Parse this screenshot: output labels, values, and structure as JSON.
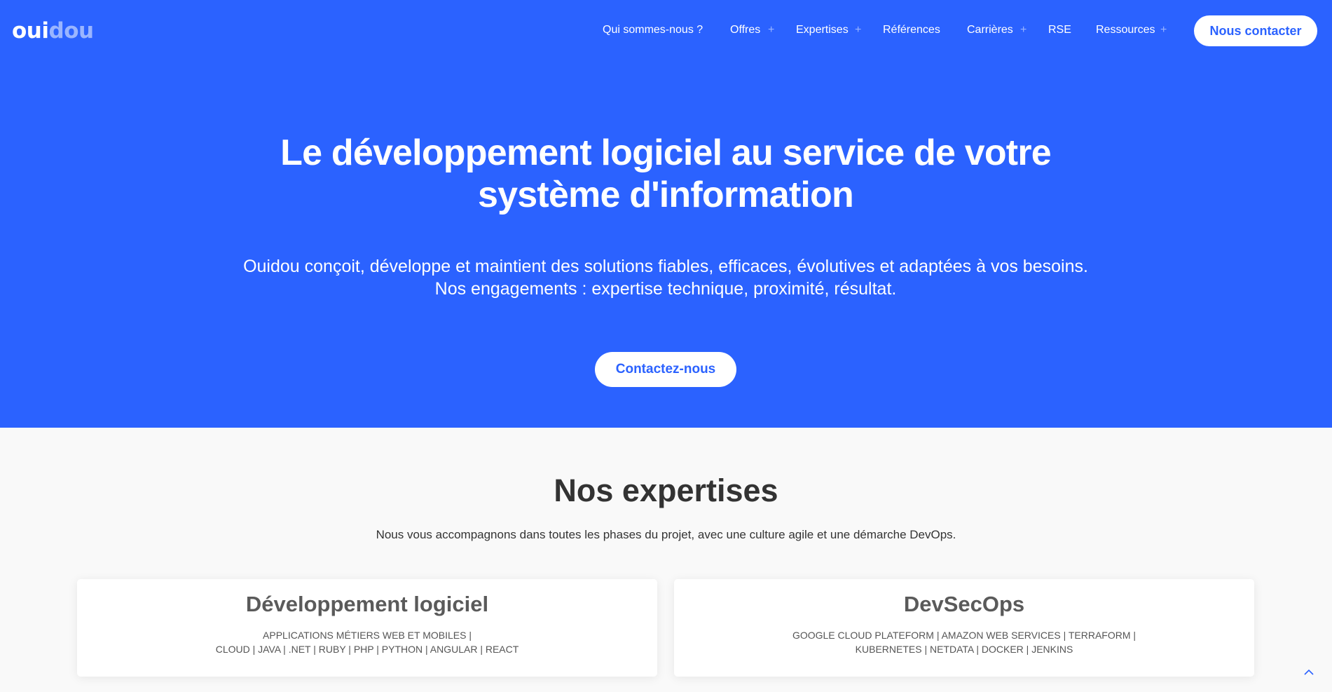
{
  "logo": {
    "part1": "oui",
    "part2": "dou"
  },
  "nav": {
    "items": [
      {
        "label": "Qui sommes-nous ?"
      },
      {
        "label": "Offres"
      },
      {
        "label": "Expertises"
      },
      {
        "label": "Références"
      },
      {
        "label": "Carrières"
      },
      {
        "label": "RSE"
      },
      {
        "label": "Ressources"
      }
    ],
    "plus_glyph": "+",
    "contact_label": "Nous contacter"
  },
  "hero": {
    "title_line1": "Le développement logiciel au service de votre",
    "title_line2": "système d'information",
    "subtitle_line1": "Ouidou conçoit, développe et maintient des solutions fiables, efficaces, évolutives et adaptées à vos besoins.",
    "subtitle_line2": "Nos engagements : expertise technique, proximité, résultat.",
    "cta_label": "Contactez-nous"
  },
  "expertises": {
    "title": "Nos expertises",
    "subtitle": "Nous vous accompagnons dans toutes les phases du projet, avec une culture agile et une démarche DevOps.",
    "cards": [
      {
        "title": "Développement logiciel",
        "tags_line1": "Applications métiers web et mobiles |",
        "tags_line2": "Cloud | Java | .NET | Ruby | PHP | Python | Angular | React"
      },
      {
        "title": "DevSecOps",
        "tags_line1": "Google Cloud Plateform | Amazon Web Services | Terraform |",
        "tags_line2": "Kubernetes | Netdata | Docker | Jenkins"
      }
    ]
  },
  "colors": {
    "brand_blue": "#2b62ff",
    "logo_accent": "#9ab5ff",
    "heading_dark": "#333333"
  },
  "icons": {
    "scroll_top": "chevron-up-icon",
    "nav_expand": "plus-icon"
  }
}
